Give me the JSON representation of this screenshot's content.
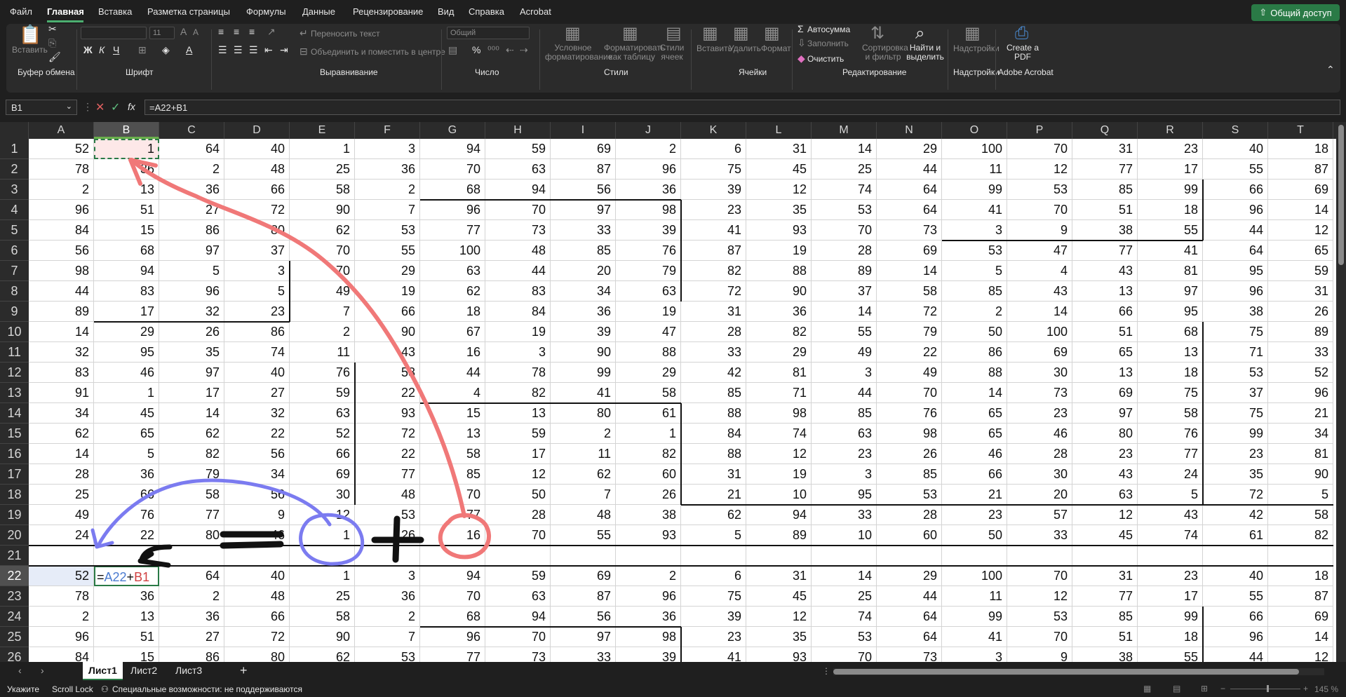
{
  "menu": {
    "items": [
      "Файл",
      "Главная",
      "Вставка",
      "Разметка страницы",
      "Формулы",
      "Данные",
      "Рецензирование",
      "Вид",
      "Справка",
      "Acrobat"
    ],
    "active_index": 1,
    "share": "Общий доступ"
  },
  "ribbon": {
    "clipboard": {
      "paste": "Вставить",
      "label": "Буфер обмена"
    },
    "font": {
      "label": "Шрифт",
      "size": "11"
    },
    "alignment": {
      "wrap": "Переносить текст",
      "merge": "Объединить и поместить в центре",
      "label": "Выравнивание"
    },
    "number": {
      "format": "Общий",
      "label": "Число"
    },
    "styles": {
      "conditional": "Условное форматирование",
      "as_table": "Форматировать как таблицу",
      "cell_styles": "Стили ячеек",
      "label": "Стили"
    },
    "cells": {
      "insert": "Вставить",
      "delete": "Удалить",
      "format": "Формат",
      "label": "Ячейки"
    },
    "editing": {
      "autosum": "Автосумма",
      "fill": "Заполнить",
      "clear": "Очистить",
      "sort": "Сортировка и фильтр",
      "find": "Найти и выделить",
      "label": "Редактирование"
    },
    "addins": {
      "button": "Надстройки",
      "label": "Надстройки"
    },
    "acrobat": {
      "button": "Create a PDF",
      "label": "Adobe Acrobat"
    }
  },
  "formula_bar": {
    "name_box": "B1",
    "fx": "fx",
    "formula": "=A22+B1"
  },
  "grid": {
    "columns": [
      "A",
      "B",
      "C",
      "D",
      "E",
      "F",
      "G",
      "H",
      "I",
      "J",
      "K",
      "L",
      "M",
      "N",
      "O",
      "P",
      "Q",
      "R",
      "S",
      "T"
    ],
    "selected_column": "B",
    "rows": [
      {
        "n": "1",
        "v": [
          "52",
          "1",
          "64",
          "40",
          "1",
          "3",
          "94",
          "59",
          "69",
          "2",
          "6",
          "31",
          "14",
          "29",
          "100",
          "70",
          "31",
          "23",
          "40",
          "18"
        ]
      },
      {
        "n": "2",
        "v": [
          "78",
          "36",
          "2",
          "48",
          "25",
          "36",
          "70",
          "63",
          "87",
          "96",
          "75",
          "45",
          "25",
          "44",
          "11",
          "12",
          "77",
          "17",
          "55",
          "87"
        ]
      },
      {
        "n": "3",
        "v": [
          "2",
          "13",
          "36",
          "66",
          "58",
          "2",
          "68",
          "94",
          "56",
          "36",
          "39",
          "12",
          "74",
          "64",
          "99",
          "53",
          "85",
          "99",
          "66",
          "69"
        ]
      },
      {
        "n": "4",
        "v": [
          "96",
          "51",
          "27",
          "72",
          "90",
          "7",
          "96",
          "70",
          "97",
          "98",
          "23",
          "35",
          "53",
          "64",
          "41",
          "70",
          "51",
          "18",
          "96",
          "14"
        ]
      },
      {
        "n": "5",
        "v": [
          "84",
          "15",
          "86",
          "80",
          "62",
          "53",
          "77",
          "73",
          "33",
          "39",
          "41",
          "93",
          "70",
          "73",
          "3",
          "9",
          "38",
          "55",
          "44",
          "12"
        ]
      },
      {
        "n": "6",
        "v": [
          "56",
          "68",
          "97",
          "37",
          "70",
          "55",
          "100",
          "48",
          "85",
          "76",
          "87",
          "19",
          "28",
          "69",
          "53",
          "47",
          "77",
          "41",
          "64",
          "65"
        ]
      },
      {
        "n": "7",
        "v": [
          "98",
          "94",
          "5",
          "3",
          "70",
          "29",
          "63",
          "44",
          "20",
          "79",
          "82",
          "88",
          "89",
          "14",
          "5",
          "4",
          "43",
          "81",
          "95",
          "59"
        ]
      },
      {
        "n": "8",
        "v": [
          "44",
          "83",
          "96",
          "5",
          "49",
          "19",
          "62",
          "83",
          "34",
          "63",
          "72",
          "90",
          "37",
          "58",
          "85",
          "43",
          "13",
          "97",
          "96",
          "31"
        ]
      },
      {
        "n": "9",
        "v": [
          "89",
          "17",
          "32",
          "23",
          "7",
          "66",
          "18",
          "84",
          "36",
          "19",
          "31",
          "36",
          "14",
          "72",
          "2",
          "14",
          "66",
          "95",
          "38",
          "26"
        ]
      },
      {
        "n": "10",
        "v": [
          "14",
          "29",
          "26",
          "86",
          "2",
          "90",
          "67",
          "19",
          "39",
          "47",
          "28",
          "82",
          "55",
          "79",
          "50",
          "100",
          "51",
          "68",
          "75",
          "89"
        ]
      },
      {
        "n": "11",
        "v": [
          "32",
          "95",
          "35",
          "74",
          "11",
          "43",
          "16",
          "3",
          "90",
          "88",
          "33",
          "29",
          "49",
          "22",
          "86",
          "69",
          "65",
          "13",
          "71",
          "33"
        ]
      },
      {
        "n": "12",
        "v": [
          "83",
          "46",
          "97",
          "40",
          "76",
          "53",
          "44",
          "78",
          "99",
          "29",
          "42",
          "81",
          "3",
          "49",
          "88",
          "30",
          "13",
          "18",
          "53",
          "52"
        ]
      },
      {
        "n": "13",
        "v": [
          "91",
          "1",
          "17",
          "27",
          "59",
          "22",
          "4",
          "82",
          "41",
          "58",
          "85",
          "71",
          "44",
          "70",
          "14",
          "73",
          "69",
          "75",
          "37",
          "96"
        ]
      },
      {
        "n": "14",
        "v": [
          "34",
          "45",
          "14",
          "32",
          "63",
          "93",
          "15",
          "13",
          "80",
          "61",
          "88",
          "98",
          "85",
          "76",
          "65",
          "23",
          "97",
          "58",
          "75",
          "21"
        ]
      },
      {
        "n": "15",
        "v": [
          "62",
          "65",
          "62",
          "22",
          "52",
          "72",
          "13",
          "59",
          "2",
          "1",
          "84",
          "74",
          "63",
          "98",
          "65",
          "46",
          "80",
          "76",
          "99",
          "34"
        ]
      },
      {
        "n": "16",
        "v": [
          "14",
          "5",
          "82",
          "56",
          "66",
          "22",
          "58",
          "17",
          "11",
          "82",
          "88",
          "12",
          "23",
          "26",
          "46",
          "28",
          "23",
          "77",
          "23",
          "81"
        ]
      },
      {
        "n": "17",
        "v": [
          "28",
          "36",
          "79",
          "34",
          "69",
          "77",
          "85",
          "12",
          "62",
          "60",
          "31",
          "19",
          "3",
          "85",
          "66",
          "30",
          "43",
          "24",
          "35",
          "90"
        ]
      },
      {
        "n": "18",
        "v": [
          "25",
          "66",
          "58",
          "56",
          "30",
          "48",
          "70",
          "50",
          "7",
          "26",
          "21",
          "10",
          "95",
          "53",
          "21",
          "20",
          "63",
          "5",
          "72",
          "5"
        ]
      },
      {
        "n": "19",
        "v": [
          "49",
          "76",
          "77",
          "9",
          "12",
          "53",
          "77",
          "28",
          "48",
          "38",
          "62",
          "94",
          "33",
          "28",
          "23",
          "57",
          "12",
          "43",
          "42",
          "58"
        ]
      },
      {
        "n": "20",
        "v": [
          "24",
          "22",
          "80",
          "46",
          "1",
          "26",
          "16",
          "70",
          "55",
          "93",
          "5",
          "89",
          "10",
          "60",
          "50",
          "33",
          "45",
          "74",
          "61",
          "82"
        ]
      },
      {
        "n": "21",
        "v": [
          "",
          "",
          "",
          "",
          "",
          "",
          "",
          "",
          "",
          "",
          "",
          "",
          "",
          "",
          "",
          "",
          "",
          "",
          "",
          ""
        ]
      },
      {
        "n": "22",
        "v": [
          "52",
          "",
          "64",
          "40",
          "1",
          "3",
          "94",
          "59",
          "69",
          "2",
          "6",
          "31",
          "14",
          "29",
          "100",
          "70",
          "31",
          "23",
          "40",
          "18"
        ]
      },
      {
        "n": "23",
        "v": [
          "78",
          "36",
          "2",
          "48",
          "25",
          "36",
          "70",
          "63",
          "87",
          "96",
          "75",
          "45",
          "25",
          "44",
          "11",
          "12",
          "77",
          "17",
          "55",
          "87"
        ]
      },
      {
        "n": "24",
        "v": [
          "2",
          "13",
          "36",
          "66",
          "58",
          "2",
          "68",
          "94",
          "56",
          "36",
          "39",
          "12",
          "74",
          "64",
          "99",
          "53",
          "85",
          "99",
          "66",
          "69"
        ]
      },
      {
        "n": "25",
        "v": [
          "96",
          "51",
          "27",
          "72",
          "90",
          "7",
          "96",
          "70",
          "97",
          "98",
          "23",
          "35",
          "53",
          "64",
          "41",
          "70",
          "51",
          "18",
          "96",
          "14"
        ]
      },
      {
        "n": "26",
        "v": [
          "84",
          "15",
          "86",
          "80",
          "62",
          "53",
          "77",
          "73",
          "33",
          "39",
          "41",
          "93",
          "70",
          "73",
          "3",
          "9",
          "38",
          "55",
          "44",
          "12"
        ]
      }
    ],
    "editing_cell": {
      "eq": "=",
      "ref1": "A22",
      "plus": "+",
      "ref2": "B1"
    }
  },
  "sheets": {
    "tabs": [
      "Лист1",
      "Лист2",
      "Лист3"
    ],
    "active_index": 0
  },
  "status": {
    "mode": "Укажите",
    "scroll_lock": "Scroll Lock",
    "accessibility": "Специальные возможности: не поддерживаются",
    "zoom": "145 %"
  },
  "colors": {
    "accent": "#2a7a46",
    "annot_red": "#f07070",
    "annot_blue": "#7b7bf0",
    "ref_blue": "#4a7bd0",
    "ref_red": "#d04040"
  }
}
